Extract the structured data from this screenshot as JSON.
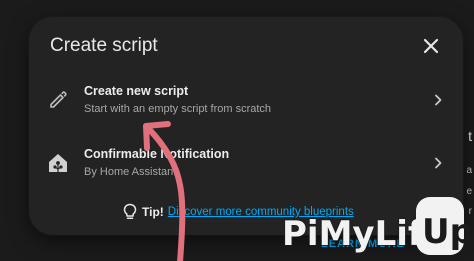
{
  "dialog": {
    "title": "Create script",
    "close_icon": "close-icon"
  },
  "options": [
    {
      "title": "Create new script",
      "subtitle": "Start with an empty script from scratch",
      "icon": "pencil-icon"
    },
    {
      "title": "Confirmable Notification",
      "subtitle": "By Home Assistant",
      "icon": "home-assistant-blueprint-icon"
    }
  ],
  "tip": {
    "label": "Tip!",
    "link_text": "Discover more community blueprints"
  },
  "background": {
    "learn_more": "LEARN MORE",
    "right_fragments": [
      "t",
      "a",
      "e",
      "r"
    ]
  },
  "watermark": {
    "text": "PiMyLifeUp"
  },
  "colors": {
    "accent": "#03a9f4",
    "dialog_bg": "#232323",
    "annotation_arrow": "#e0707c"
  }
}
